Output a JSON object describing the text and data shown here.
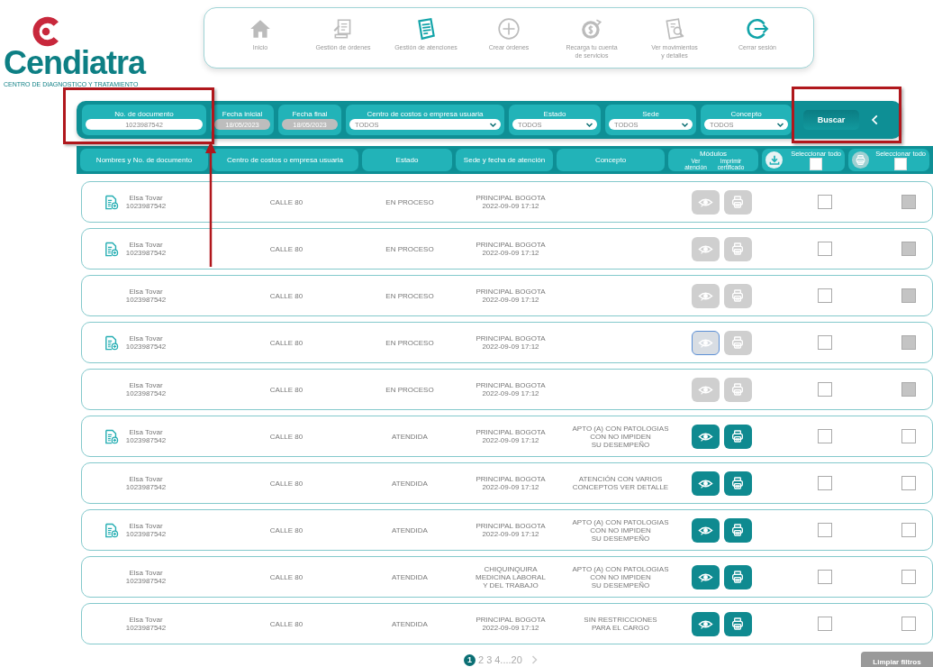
{
  "logo": {
    "name": "Cendiatra",
    "tagline": "CENTRO DE DIAGNOSTICO Y TRATAMIENTO"
  },
  "nav": [
    {
      "label_lines": [
        "Inicio"
      ],
      "highlighted": false
    },
    {
      "label_lines": [
        "Gestión de órdenes"
      ],
      "highlighted": false
    },
    {
      "label_lines": [
        "Gestión de atenciones"
      ],
      "highlighted": true
    },
    {
      "label_lines": [
        "Crear órdenes"
      ],
      "highlighted": false
    },
    {
      "label_lines": [
        "Recarga tu cuenta",
        "de servicios"
      ],
      "highlighted": false
    },
    {
      "label_lines": [
        "Ver movimientos",
        "y detalles"
      ],
      "highlighted": false
    },
    {
      "label_lines": [
        "Cerrar sesión"
      ],
      "highlighted": true
    }
  ],
  "filters": [
    {
      "kind": "text",
      "label": "No. de documento",
      "value": "1023987542",
      "disabled": false
    },
    {
      "kind": "text",
      "label": "Fecha inicial",
      "value": "18/05/2023",
      "disabled": true
    },
    {
      "kind": "text",
      "label": "Fecha final",
      "value": "18/05/2023",
      "disabled": true
    },
    {
      "kind": "select",
      "label": "Centro de costos o empresa usuaria",
      "value": "TODOS",
      "disabled": false
    },
    {
      "kind": "select",
      "label": "Estado",
      "value": "TODOS",
      "disabled": false
    },
    {
      "kind": "select",
      "label": "Sede",
      "value": "TODOS",
      "disabled": false
    },
    {
      "kind": "select",
      "label": "Concepto",
      "value": "TODOS",
      "disabled": false
    }
  ],
  "search_button": "Buscar",
  "columns": [
    {
      "kind": "text",
      "label": "Nombres y No. de documento"
    },
    {
      "kind": "text",
      "label": "Centro de costos o empresa usuaria"
    },
    {
      "kind": "text",
      "label": "Estado"
    },
    {
      "kind": "text",
      "label": "Sede y fecha de atención"
    },
    {
      "kind": "text",
      "label": "Concepto"
    },
    {
      "kind": "modules",
      "label": "Módulos",
      "sub": [
        "Ver atención",
        "Imprimir certificado"
      ]
    },
    {
      "kind": "select_all",
      "label": "Seleccionar todo",
      "checked": false,
      "disabled": false
    },
    {
      "kind": "select_all",
      "label": "Seleccionar todo",
      "checked": false,
      "disabled": true
    }
  ],
  "rows": [
    {
      "attachment": true,
      "name": "Elsa Tovar",
      "document": "1023987542",
      "cost_center": "CALLE 80",
      "status": "EN PROCESO",
      "site_lines": [
        "PRINCIPAL BOGOTA",
        "2022-09-09 17:12"
      ],
      "concept_lines": [],
      "actions_enabled": false,
      "view_focused": false,
      "download_checked": false,
      "print_check_disabled": true
    },
    {
      "attachment": true,
      "name": "Elsa Tovar",
      "document": "1023987542",
      "cost_center": "CALLE 80",
      "status": "EN PROCESO",
      "site_lines": [
        "PRINCIPAL BOGOTA",
        "2022-09-09 17:12"
      ],
      "concept_lines": [],
      "actions_enabled": false,
      "view_focused": false,
      "download_checked": false,
      "print_check_disabled": true
    },
    {
      "attachment": false,
      "name": "Elsa Tovar",
      "document": "1023987542",
      "cost_center": "CALLE 80",
      "status": "EN PROCESO",
      "site_lines": [
        "PRINCIPAL BOGOTA",
        "2022-09-09 17:12"
      ],
      "concept_lines": [],
      "actions_enabled": false,
      "view_focused": false,
      "download_checked": false,
      "print_check_disabled": true
    },
    {
      "attachment": true,
      "name": "Elsa Tovar",
      "document": "1023987542",
      "cost_center": "CALLE 80",
      "status": "EN PROCESO",
      "site_lines": [
        "PRINCIPAL BOGOTA",
        "2022-09-09 17:12"
      ],
      "concept_lines": [],
      "actions_enabled": false,
      "view_focused": true,
      "download_checked": false,
      "print_check_disabled": true
    },
    {
      "attachment": false,
      "name": "Elsa Tovar",
      "document": "1023987542",
      "cost_center": "CALLE 80",
      "status": "EN PROCESO",
      "site_lines": [
        "PRINCIPAL BOGOTA",
        "2022-09-09 17:12"
      ],
      "concept_lines": [],
      "actions_enabled": false,
      "view_focused": false,
      "download_checked": false,
      "print_check_disabled": true
    },
    {
      "attachment": true,
      "name": "Elsa Tovar",
      "document": "1023987542",
      "cost_center": "CALLE 80",
      "status": "ATENDIDA",
      "site_lines": [
        "PRINCIPAL BOGOTA",
        "2022-09-09 17:12"
      ],
      "concept_lines": [
        "APTO (A) CON PATOLOGIAS",
        "CON NO IMPIDEN",
        "SU DESEMPEÑO"
      ],
      "actions_enabled": true,
      "view_focused": false,
      "download_checked": false,
      "print_check_disabled": false
    },
    {
      "attachment": false,
      "name": "Elsa Tovar",
      "document": "1023987542",
      "cost_center": "CALLE 80",
      "status": "ATENDIDA",
      "site_lines": [
        "PRINCIPAL BOGOTA",
        "2022-09-09 17:12"
      ],
      "concept_lines": [
        "ATENCIÓN CON VARIOS",
        "CONCEPTOS VER DETALLE"
      ],
      "actions_enabled": true,
      "view_focused": false,
      "download_checked": false,
      "print_check_disabled": false
    },
    {
      "attachment": true,
      "name": "Elsa Tovar",
      "document": "1023987542",
      "cost_center": "CALLE 80",
      "status": "ATENDIDA",
      "site_lines": [
        "PRINCIPAL BOGOTA",
        "2022-09-09 17:12"
      ],
      "concept_lines": [
        "APTO (A) CON PATOLOGIAS",
        "CON NO IMPIDEN",
        "SU DESEMPEÑO"
      ],
      "actions_enabled": true,
      "view_focused": false,
      "download_checked": false,
      "print_check_disabled": false
    },
    {
      "attachment": false,
      "name": "Elsa Tovar",
      "document": "1023987542",
      "cost_center": "CALLE 80",
      "status": "ATENDIDA",
      "site_lines": [
        "CHIQUINQUIRA",
        "MEDICINA LABORAL",
        "Y DEL TRABAJO"
      ],
      "concept_lines": [
        "APTO (A) CON PATOLOGIAS",
        "CON NO IMPIDEN",
        "SU DESEMPEÑO"
      ],
      "actions_enabled": true,
      "view_focused": false,
      "download_checked": false,
      "print_check_disabled": false
    },
    {
      "attachment": false,
      "name": "Elsa Tovar",
      "document": "1023987542",
      "cost_center": "CALLE 80",
      "status": "ATENDIDA",
      "site_lines": [
        "PRINCIPAL BOGOTA",
        "2022-09-09 17:12"
      ],
      "concept_lines": [
        "SIN RESTRICCIONES",
        "PARA EL CARGO"
      ],
      "actions_enabled": true,
      "view_focused": false,
      "download_checked": false,
      "print_check_disabled": false
    }
  ],
  "pagination": [
    {
      "label": "1",
      "selected": true
    },
    {
      "label": "2",
      "selected": false
    },
    {
      "label": "3",
      "selected": false
    },
    {
      "label": "4....20",
      "selected": false
    }
  ],
  "clear_button": "Limpiar filtros"
}
